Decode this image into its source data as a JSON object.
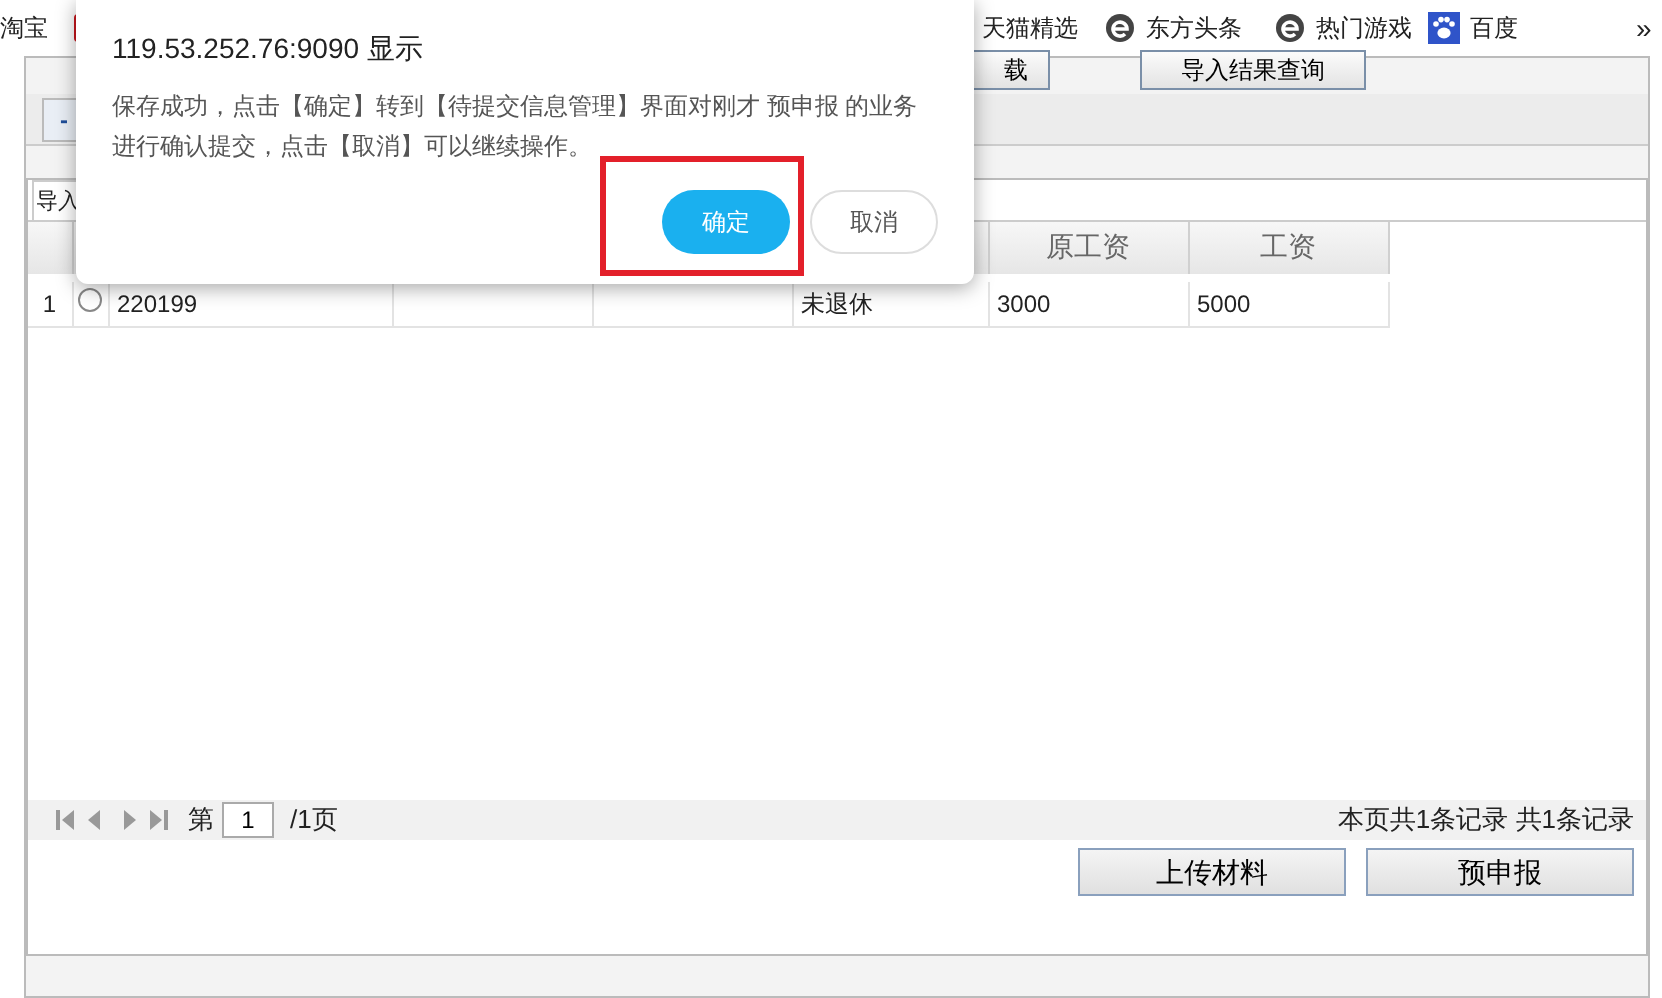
{
  "bookmarks": [
    {
      "label": "淘宝"
    },
    {
      "label": "天猫精选"
    },
    {
      "label": "东方头条"
    },
    {
      "label": "热门游戏"
    },
    {
      "label": "百度"
    }
  ],
  "bookmarks_more": "»",
  "toolbar_buttons": [
    "载",
    "导入结果查询"
  ],
  "collapse_button": "-",
  "panel_tab": "导入",
  "table": {
    "columns": [
      "",
      "",
      "",
      "",
      "原工资",
      "工资"
    ],
    "rows": [
      {
        "index": "1",
        "selected": false,
        "cells": [
          "220199",
          "",
          "",
          "未退休",
          "3000",
          "5000"
        ]
      }
    ]
  },
  "pager": {
    "prefix": "第",
    "page": "1",
    "suffix": "/1页",
    "summary": "本页共1条记录 共1条记录"
  },
  "action_buttons": [
    "上传材料",
    "预申报"
  ],
  "dialog": {
    "title": "119.53.252.76:9090 显示",
    "message": "保存成功，点击【确定】转到【待提交信息管理】界面对刚才 预申报 的业务进行确认提交，点击【取消】可以继续操作。",
    "ok": "确定",
    "cancel": "取消",
    "ok_highlighted": true
  }
}
